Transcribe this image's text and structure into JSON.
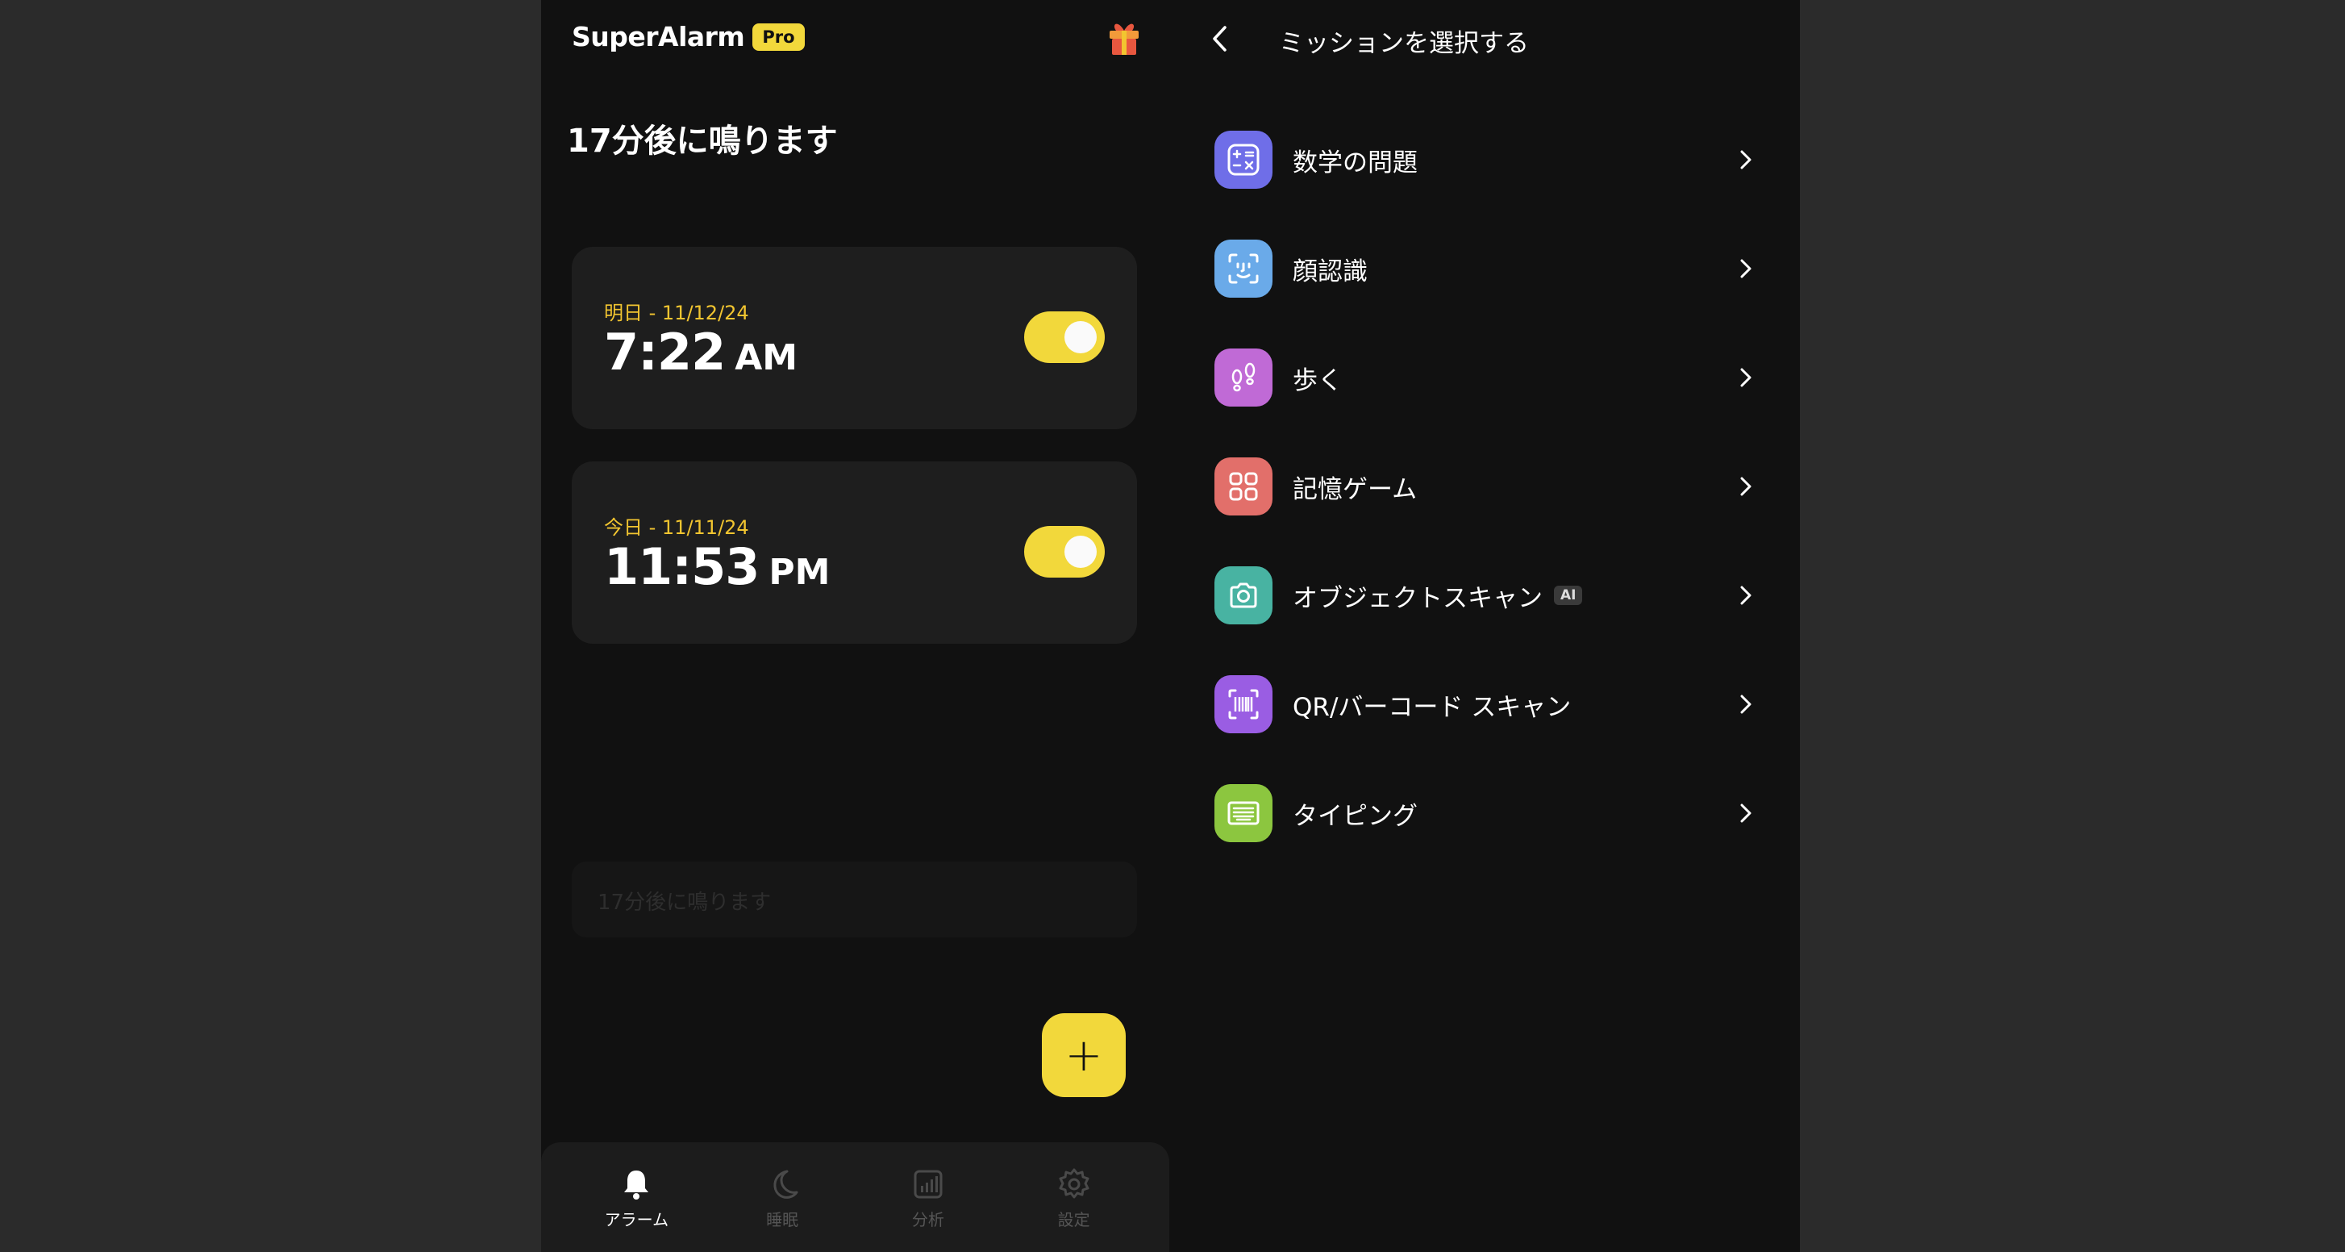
{
  "left": {
    "brand": {
      "name": "SuperAlarm",
      "badge": "Pro"
    },
    "countdown": "17分後に鳴ります",
    "alarms": [
      {
        "date": "明日 - 11/12/24",
        "time": "7:22",
        "period": "AM",
        "enabled": true
      },
      {
        "date": "今日 - 11/11/24",
        "time": "11:53",
        "period": "PM",
        "enabled": true
      }
    ],
    "ghost_text": "17分後に鳴ります",
    "fab_label": "+",
    "nav": [
      {
        "label": "アラーム",
        "icon": "bell-icon",
        "active": true
      },
      {
        "label": "睡眠",
        "icon": "moon-icon",
        "active": false
      },
      {
        "label": "分析",
        "icon": "chart-icon",
        "active": false
      },
      {
        "label": "設定",
        "icon": "gear-icon",
        "active": false
      }
    ]
  },
  "right": {
    "title": "ミッションを選択する",
    "missions": [
      {
        "label": "数学の問題",
        "icon": "math-icon",
        "color": "#6f6ee8"
      },
      {
        "label": "顔認識",
        "icon": "face-id-icon",
        "color": "#6aaae9"
      },
      {
        "label": "歩く",
        "icon": "footsteps-icon",
        "color": "#c06ad6"
      },
      {
        "label": "記憶ゲーム",
        "icon": "grid-icon",
        "color": "#e26f6a"
      },
      {
        "label": "オブジェクトスキャン",
        "badge": "AI",
        "icon": "camera-icon",
        "color": "#48b3a2"
      },
      {
        "label": "QR/バーコード スキャン",
        "icon": "barcode-icon",
        "color": "#9a5de3"
      },
      {
        "label": "タイピング",
        "icon": "keyboard-icon",
        "color": "#8cc63f"
      }
    ]
  },
  "colors": {
    "accent": "#f2d83b",
    "date_text": "#f2c530",
    "background": "#111111",
    "card": "#1e1e1e",
    "outer": "#2b2b2b"
  }
}
